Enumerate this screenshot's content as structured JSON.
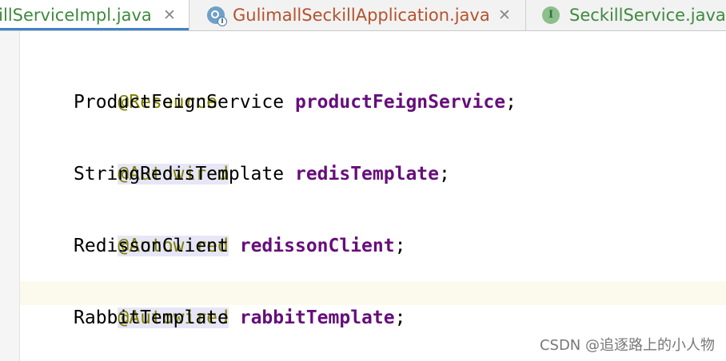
{
  "tabs": [
    {
      "label": "killServiceImpl.java",
      "active": true,
      "label_color": "#3e8a3e"
    },
    {
      "label": "GulimallSeckillApplication.java",
      "active": false,
      "label_color": "#b5522b",
      "icon": "spring-boot-app-icon"
    },
    {
      "label": "SeckillService.java",
      "active": false,
      "label_color": "#3e8a3e",
      "icon": "interface-icon",
      "icon_letter": "I"
    }
  ],
  "close_glyph": "✕",
  "code": [
    {
      "annotation": "@Resource",
      "type": "ProductFeignService",
      "field": "productFeignService",
      "semicolon": ";"
    },
    {
      "annotation": "@Autowired",
      "type": "StringRedisTemplate",
      "field": "redisTemplate",
      "semicolon": ";"
    },
    {
      "annotation": "@Autowired",
      "type": "RedissonClient",
      "field": "redissonClient",
      "semicolon": ";"
    },
    {
      "annotation": "@Autowired",
      "type": "RabbitTemplate",
      "field": "rabbitTemplate",
      "semicolon": ";"
    }
  ],
  "watermark": "CSDN @追逐路上的小人物",
  "colors": {
    "annotation": "#808000",
    "field": "#660e7a",
    "active_tab_underline": "#4083c9",
    "current_line": "#fcfaed"
  }
}
